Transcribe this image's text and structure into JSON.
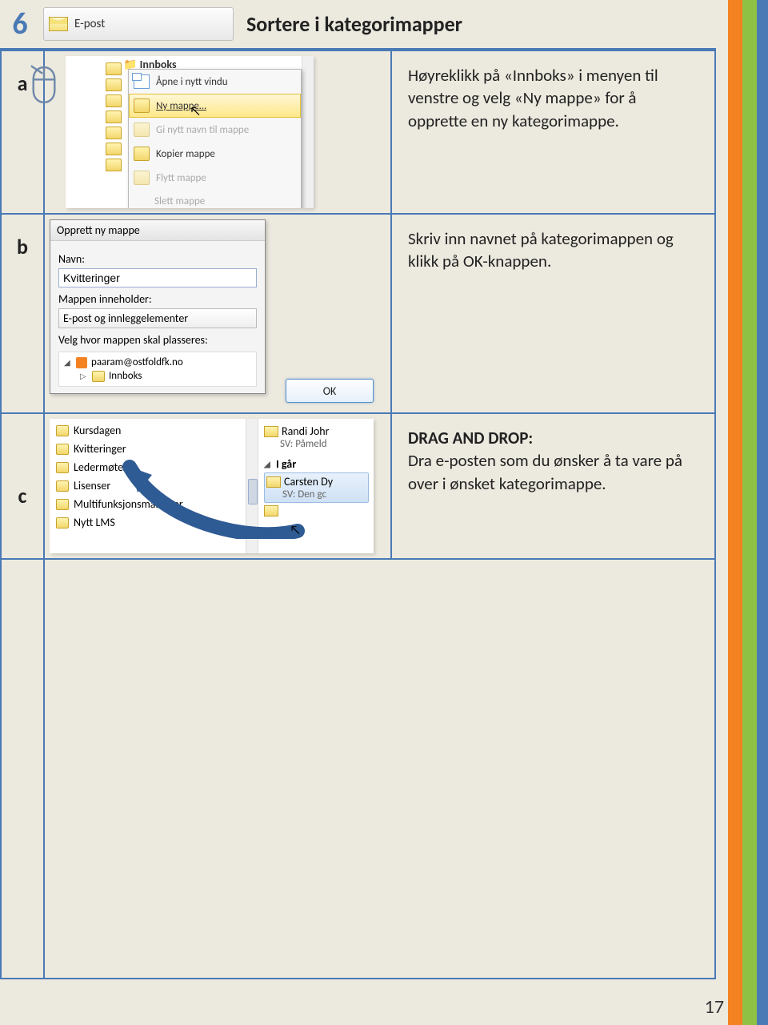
{
  "page_number": "17",
  "section": {
    "num": "6",
    "badge": "E-post",
    "title": "Sortere i kategorimapper"
  },
  "rows": {
    "a": {
      "label": "a",
      "desc": "Høyreklikk på «Innboks» i menyen til venstre og velg «Ny mappe» for å opprette en ny kategorimappe.",
      "inbox_label": "Innboks",
      "menu": {
        "open_new_window": "Åpne i nytt vindu",
        "new_folder": "Ny mappe…",
        "rename": "Gi nytt navn til mappe",
        "copy": "Kopier mappe",
        "move": "Flytt mappe",
        "delete": "Slett mappe"
      }
    },
    "b": {
      "label": "b",
      "desc": "Skriv inn navnet på kategorimappen og klikk på OK-knappen.",
      "dlg": {
        "title": "Opprett ny mappe",
        "name_label": "Navn:",
        "name_value": "Kvitteringer",
        "contains_label": "Mappen inneholder:",
        "contains_value": "E-post og innleggelementer",
        "place_label": "Velg hvor mappen skal plasseres:",
        "account": "paaram@ostfoldfk.no",
        "inbox": "Innboks",
        "ok": "OK"
      }
    },
    "c": {
      "label": "c",
      "desc_heading": "DRAG AND DROP:",
      "desc_text": "Dra e-posten som du ønsker å ta vare på over i ønsket kategorimappe.",
      "folders": [
        "Kursdagen",
        "Kvitteringer",
        "Ledermøter",
        "Lisenser",
        "Multifunksjonsmaskiner",
        "Nytt LMS"
      ],
      "mails": {
        "top_from": "Randi Johr",
        "top_sub": "SV: Påmeld",
        "group": "I går",
        "sel_from": "Carsten Dy",
        "sel_sub": "SV: Den gc"
      }
    }
  }
}
